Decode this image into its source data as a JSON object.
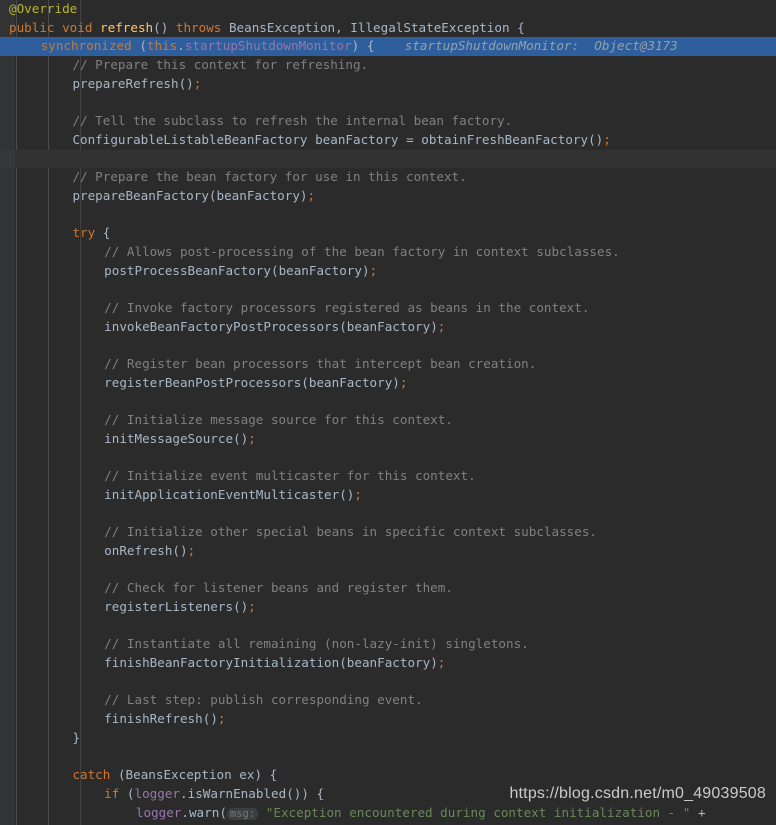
{
  "editor": {
    "theme_background": "#2b2b2b",
    "gutter_background": "#313335",
    "exec_line_highlight": "#2f5e9c",
    "foreground": "#a9b7c6",
    "keyword_color": "#cc7832",
    "comment_color": "#808080",
    "string_color": "#6a8759",
    "field_color": "#9876aa",
    "method_color": "#ffc66d",
    "annotation_color": "#bbb529"
  },
  "watermark": {
    "text": "https://blog.csdn.net/m0_49039508"
  },
  "debug_inline_value": {
    "variable": "startupShutdownMonitor",
    "separator": ":",
    "value": "Object@3173",
    "full": "startupShutdownMonitor:  Object@3173"
  },
  "code": {
    "language": "java",
    "lines": [
      {
        "n": 1,
        "indent": 0,
        "state": "normal",
        "tokens": [
          {
            "t": "@Override",
            "c": "anno"
          }
        ]
      },
      {
        "n": 2,
        "indent": 0,
        "state": "normal",
        "tokens": [
          {
            "t": "public",
            "c": "kw"
          },
          {
            "t": " ",
            "c": "punc"
          },
          {
            "t": "void",
            "c": "kw"
          },
          {
            "t": " ",
            "c": "punc"
          },
          {
            "t": "refresh",
            "c": "fn"
          },
          {
            "t": "()",
            "c": "paren"
          },
          {
            "t": " ",
            "c": "punc"
          },
          {
            "t": "throws",
            "c": "kw"
          },
          {
            "t": " ",
            "c": "punc"
          },
          {
            "t": "BeansException",
            "c": "type"
          },
          {
            "t": ", ",
            "c": "punc"
          },
          {
            "t": "IllegalStateException",
            "c": "type"
          },
          {
            "t": " {",
            "c": "paren"
          }
        ]
      },
      {
        "n": 3,
        "indent": 1,
        "state": "exec",
        "tokens": [
          {
            "t": "synchronized",
            "c": "kw"
          },
          {
            "t": " ",
            "c": "punc"
          },
          {
            "t": "(",
            "c": "paren"
          },
          {
            "t": "this",
            "c": "kw"
          },
          {
            "t": ".",
            "c": "punc"
          },
          {
            "t": "startupShutdownMonitor",
            "c": "field"
          },
          {
            "t": ")",
            "c": "paren"
          },
          {
            "t": " {",
            "c": "paren"
          }
        ],
        "inline_hint": "startupShutdownMonitor:  Object@3173"
      },
      {
        "n": 4,
        "indent": 2,
        "state": "normal",
        "tokens": [
          {
            "t": "// Prepare this context for refreshing.",
            "c": "cmt"
          }
        ]
      },
      {
        "n": 5,
        "indent": 2,
        "state": "normal",
        "tokens": [
          {
            "t": "prepareRefresh",
            "c": "id"
          },
          {
            "t": "()",
            "c": "paren"
          },
          {
            "t": ";",
            "c": "semi"
          }
        ]
      },
      {
        "n": 6,
        "indent": 0,
        "state": "normal",
        "tokens": []
      },
      {
        "n": 7,
        "indent": 2,
        "state": "normal",
        "tokens": [
          {
            "t": "// Tell the subclass to refresh the internal bean factory.",
            "c": "cmt"
          }
        ]
      },
      {
        "n": 8,
        "indent": 2,
        "state": "normal",
        "tokens": [
          {
            "t": "ConfigurableListableBeanFactory",
            "c": "type"
          },
          {
            "t": " ",
            "c": "punc"
          },
          {
            "t": "beanFactory",
            "c": "id"
          },
          {
            "t": " ",
            "c": "punc"
          },
          {
            "t": "=",
            "c": "punc"
          },
          {
            "t": " ",
            "c": "punc"
          },
          {
            "t": "obtainFreshBeanFactory",
            "c": "id"
          },
          {
            "t": "()",
            "c": "paren"
          },
          {
            "t": ";",
            "c": "semi"
          }
        ]
      },
      {
        "n": 9,
        "indent": 0,
        "state": "band",
        "tokens": []
      },
      {
        "n": 10,
        "indent": 2,
        "state": "normal",
        "tokens": [
          {
            "t": "// Prepare the bean factory for use in this context.",
            "c": "cmt"
          }
        ]
      },
      {
        "n": 11,
        "indent": 2,
        "state": "normal",
        "tokens": [
          {
            "t": "prepareBeanFactory",
            "c": "id"
          },
          {
            "t": "(",
            "c": "paren"
          },
          {
            "t": "beanFactory",
            "c": "id"
          },
          {
            "t": ")",
            "c": "paren"
          },
          {
            "t": ";",
            "c": "semi"
          }
        ]
      },
      {
        "n": 12,
        "indent": 0,
        "state": "normal",
        "tokens": []
      },
      {
        "n": 13,
        "indent": 2,
        "state": "normal",
        "tokens": [
          {
            "t": "try",
            "c": "kw"
          },
          {
            "t": " {",
            "c": "paren"
          }
        ]
      },
      {
        "n": 14,
        "indent": 3,
        "state": "normal",
        "tokens": [
          {
            "t": "// Allows post-processing of the bean factory in context subclasses.",
            "c": "cmt"
          }
        ]
      },
      {
        "n": 15,
        "indent": 3,
        "state": "normal",
        "tokens": [
          {
            "t": "postProcessBeanFactory",
            "c": "id"
          },
          {
            "t": "(",
            "c": "paren"
          },
          {
            "t": "beanFactory",
            "c": "id"
          },
          {
            "t": ")",
            "c": "paren"
          },
          {
            "t": ";",
            "c": "semi"
          }
        ]
      },
      {
        "n": 16,
        "indent": 0,
        "state": "normal",
        "tokens": []
      },
      {
        "n": 17,
        "indent": 3,
        "state": "normal",
        "tokens": [
          {
            "t": "// Invoke factory processors registered as beans in the context.",
            "c": "cmt"
          }
        ]
      },
      {
        "n": 18,
        "indent": 3,
        "state": "normal",
        "tokens": [
          {
            "t": "invokeBeanFactoryPostProcessors",
            "c": "id"
          },
          {
            "t": "(",
            "c": "paren"
          },
          {
            "t": "beanFactory",
            "c": "id"
          },
          {
            "t": ")",
            "c": "paren"
          },
          {
            "t": ";",
            "c": "semi"
          }
        ]
      },
      {
        "n": 19,
        "indent": 0,
        "state": "normal",
        "tokens": []
      },
      {
        "n": 20,
        "indent": 3,
        "state": "normal",
        "tokens": [
          {
            "t": "// Register bean processors that intercept bean creation.",
            "c": "cmt"
          }
        ]
      },
      {
        "n": 21,
        "indent": 3,
        "state": "normal",
        "tokens": [
          {
            "t": "registerBeanPostProcessors",
            "c": "id"
          },
          {
            "t": "(",
            "c": "paren"
          },
          {
            "t": "beanFactory",
            "c": "id"
          },
          {
            "t": ")",
            "c": "paren"
          },
          {
            "t": ";",
            "c": "semi"
          }
        ]
      },
      {
        "n": 22,
        "indent": 0,
        "state": "normal",
        "tokens": []
      },
      {
        "n": 23,
        "indent": 3,
        "state": "normal",
        "tokens": [
          {
            "t": "// Initialize message source for this context.",
            "c": "cmt"
          }
        ]
      },
      {
        "n": 24,
        "indent": 3,
        "state": "normal",
        "tokens": [
          {
            "t": "initMessageSource",
            "c": "id"
          },
          {
            "t": "()",
            "c": "paren"
          },
          {
            "t": ";",
            "c": "semi"
          }
        ]
      },
      {
        "n": 25,
        "indent": 0,
        "state": "normal",
        "tokens": []
      },
      {
        "n": 26,
        "indent": 3,
        "state": "normal",
        "tokens": [
          {
            "t": "// Initialize event multicaster for this context.",
            "c": "cmt"
          }
        ]
      },
      {
        "n": 27,
        "indent": 3,
        "state": "normal",
        "tokens": [
          {
            "t": "initApplicationEventMulticaster",
            "c": "id"
          },
          {
            "t": "()",
            "c": "paren"
          },
          {
            "t": ";",
            "c": "semi"
          }
        ]
      },
      {
        "n": 28,
        "indent": 0,
        "state": "normal",
        "tokens": []
      },
      {
        "n": 29,
        "indent": 3,
        "state": "normal",
        "tokens": [
          {
            "t": "// Initialize other special beans in specific context subclasses.",
            "c": "cmt"
          }
        ]
      },
      {
        "n": 30,
        "indent": 3,
        "state": "normal",
        "tokens": [
          {
            "t": "onRefresh",
            "c": "id"
          },
          {
            "t": "()",
            "c": "paren"
          },
          {
            "t": ";",
            "c": "semi"
          }
        ]
      },
      {
        "n": 31,
        "indent": 0,
        "state": "normal",
        "tokens": []
      },
      {
        "n": 32,
        "indent": 3,
        "state": "normal",
        "tokens": [
          {
            "t": "// Check for listener beans and register them.",
            "c": "cmt"
          }
        ]
      },
      {
        "n": 33,
        "indent": 3,
        "state": "normal",
        "tokens": [
          {
            "t": "registerListeners",
            "c": "id"
          },
          {
            "t": "()",
            "c": "paren"
          },
          {
            "t": ";",
            "c": "semi"
          }
        ]
      },
      {
        "n": 34,
        "indent": 0,
        "state": "normal",
        "tokens": []
      },
      {
        "n": 35,
        "indent": 3,
        "state": "normal",
        "tokens": [
          {
            "t": "// Instantiate all remaining (non-lazy-init) singletons.",
            "c": "cmt"
          }
        ]
      },
      {
        "n": 36,
        "indent": 3,
        "state": "normal",
        "tokens": [
          {
            "t": "finishBeanFactoryInitialization",
            "c": "id"
          },
          {
            "t": "(",
            "c": "paren"
          },
          {
            "t": "beanFactory",
            "c": "id"
          },
          {
            "t": ")",
            "c": "paren"
          },
          {
            "t": ";",
            "c": "semi"
          }
        ]
      },
      {
        "n": 37,
        "indent": 0,
        "state": "normal",
        "tokens": []
      },
      {
        "n": 38,
        "indent": 3,
        "state": "normal",
        "tokens": [
          {
            "t": "// Last step: publish corresponding event.",
            "c": "cmt"
          }
        ]
      },
      {
        "n": 39,
        "indent": 3,
        "state": "normal",
        "tokens": [
          {
            "t": "finishRefresh",
            "c": "id"
          },
          {
            "t": "()",
            "c": "paren"
          },
          {
            "t": ";",
            "c": "semi"
          }
        ]
      },
      {
        "n": 40,
        "indent": 2,
        "state": "normal",
        "tokens": [
          {
            "t": "}",
            "c": "paren"
          }
        ]
      },
      {
        "n": 41,
        "indent": 0,
        "state": "normal",
        "tokens": []
      },
      {
        "n": 42,
        "indent": 2,
        "state": "normal",
        "tokens": [
          {
            "t": "catch",
            "c": "kw"
          },
          {
            "t": " ",
            "c": "punc"
          },
          {
            "t": "(",
            "c": "paren"
          },
          {
            "t": "BeansException",
            "c": "type"
          },
          {
            "t": " ",
            "c": "punc"
          },
          {
            "t": "ex",
            "c": "id"
          },
          {
            "t": ")",
            "c": "paren"
          },
          {
            "t": " {",
            "c": "paren"
          }
        ]
      },
      {
        "n": 43,
        "indent": 3,
        "state": "normal",
        "tokens": [
          {
            "t": "if",
            "c": "kw"
          },
          {
            "t": " ",
            "c": "punc"
          },
          {
            "t": "(",
            "c": "paren"
          },
          {
            "t": "logger",
            "c": "field"
          },
          {
            "t": ".",
            "c": "punc"
          },
          {
            "t": "isWarnEnabled",
            "c": "id"
          },
          {
            "t": "()",
            "c": "paren"
          },
          {
            "t": ")",
            "c": "paren"
          },
          {
            "t": " {",
            "c": "paren"
          }
        ]
      },
      {
        "n": 44,
        "indent": 4,
        "state": "normal",
        "tokens": [
          {
            "t": "logger",
            "c": "field"
          },
          {
            "t": ".",
            "c": "punc"
          },
          {
            "t": "warn",
            "c": "id"
          },
          {
            "t": "(",
            "c": "paren"
          },
          {
            "t": "msg:",
            "c": "inlay"
          },
          {
            "t": " ",
            "c": "punc"
          },
          {
            "t": "\"Exception encountered during context initialization - \"",
            "c": "str"
          },
          {
            "t": " +",
            "c": "punc"
          }
        ]
      }
    ]
  }
}
